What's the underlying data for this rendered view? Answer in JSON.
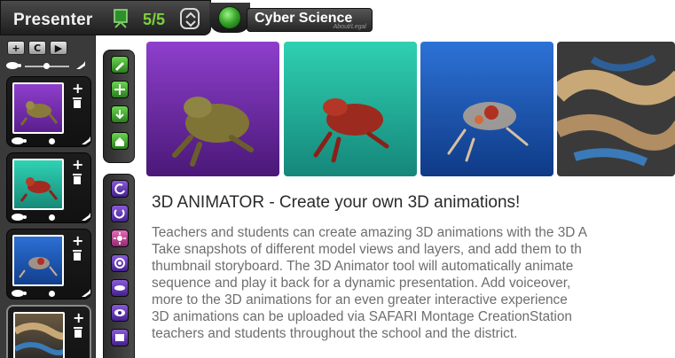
{
  "header": {
    "title": "Presenter",
    "slide_count": "5/5",
    "brand": "Cyber Science",
    "brand_sub": "About/Legal"
  },
  "toolbar": {
    "add_label": "+",
    "clear_label": "C",
    "play_label": "▶"
  },
  "slides": [
    {
      "name": "frog-purple",
      "background": "#6a2fa0",
      "add": "+"
    },
    {
      "name": "frog-teal",
      "background": "#1fb09a",
      "add": "+"
    },
    {
      "name": "frog-blue",
      "background": "#1d5fb8",
      "add": "+"
    },
    {
      "name": "frog-organs",
      "background": "#5a4a3a",
      "add": "+"
    }
  ],
  "tool_strip": {
    "upper": [
      "pencil-icon",
      "move-icon",
      "download-icon",
      "home-icon"
    ],
    "lower": [
      "rotate-left-icon",
      "rotate-down-icon",
      "explode-icon",
      "layers-icon",
      "lips-icon",
      "eye-icon",
      "window-icon"
    ]
  },
  "images": [
    {
      "name": "frog-on-purple",
      "bg_top": "#8e3fcc",
      "bg_bottom": "#5a1e8e"
    },
    {
      "name": "frog-skeleton-on-teal",
      "bg_top": "#30d2b4",
      "bg_bottom": "#168a78"
    },
    {
      "name": "frog-organs-on-blue",
      "bg_top": "#2c6fd4",
      "bg_bottom": "#123f8e"
    },
    {
      "name": "frog-internal-closeup",
      "bg_top": "#b89a70",
      "bg_bottom": "#3a3a3a"
    }
  ],
  "content": {
    "heading": "3D ANIMATOR - Create your own 3D animations!",
    "lines": [
      "Teachers and students can create amazing 3D animations with the 3D A",
      "Take snapshots of different model views and layers, and add them to th",
      "thumbnail storyboard. The 3D Animator tool will automatically animate",
      "sequence and play it back for a dynamic presentation. Add voiceover,",
      "more to the 3D animations for an even greater interactive experience",
      "3D animations can be uploaded via SAFARI Montage CreationStation",
      "teachers and students throughout the school and the district."
    ]
  },
  "colors": {
    "accent_green": "#7bd23a",
    "panel_dark": "#3a3a3a",
    "heading_text": "#2a2a2a",
    "body_text": "#6e6e6e"
  }
}
